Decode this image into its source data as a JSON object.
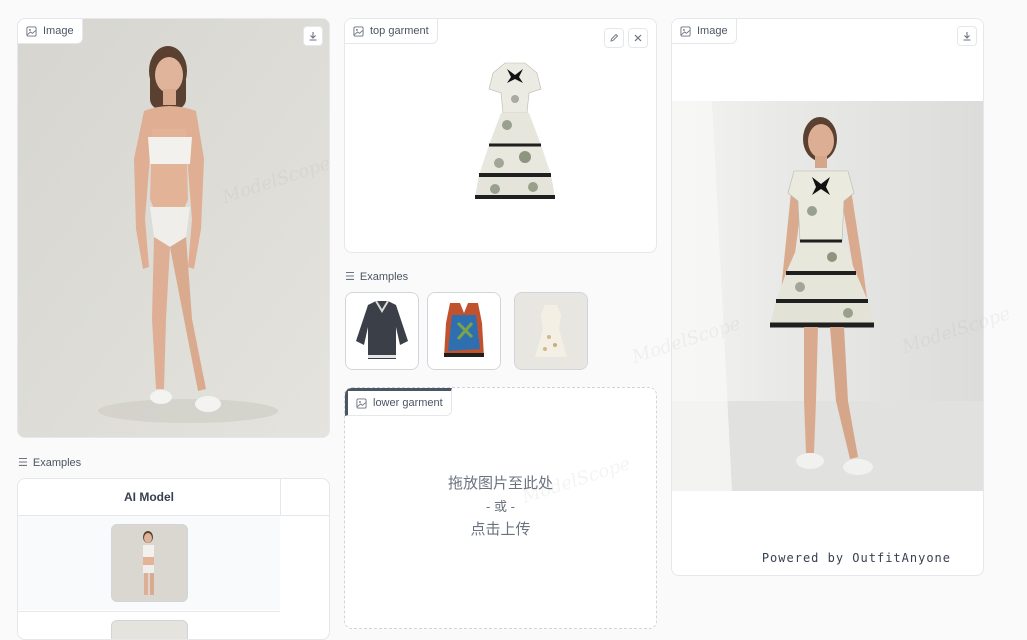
{
  "person_panel": {
    "label": "Image",
    "download_icon": "download-icon"
  },
  "person_examples": {
    "label": "Examples",
    "column_header": "AI Model"
  },
  "top_garment_panel": {
    "label": "top garment",
    "edit_icon": "pencil-icon",
    "close_icon": "close-icon"
  },
  "top_examples": {
    "label": "Examples"
  },
  "lower_garment_panel": {
    "label": "lower garment",
    "drop_line1": "拖放图片至此处",
    "drop_line2": "- 或 -",
    "drop_line3": "点击上传"
  },
  "result_panel": {
    "label": "Image",
    "download_icon": "download-icon",
    "powered_by": "Powered by OutfitAnyone"
  },
  "watermark_text": "ModelScope",
  "colors": {
    "border": "#e5e7eb",
    "text": "#374151",
    "muted": "#6b7280"
  }
}
